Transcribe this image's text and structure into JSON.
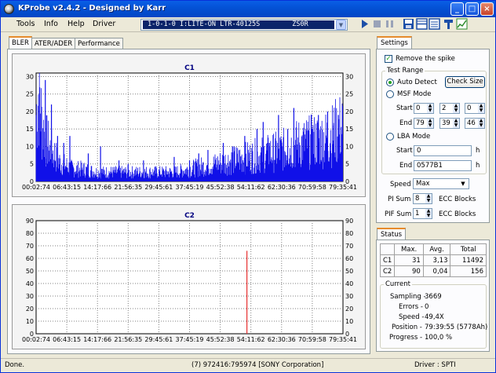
{
  "window": {
    "title": "KProbe v2.4.2 - Designed by Karr"
  },
  "menu": [
    "Tools",
    "Info",
    "Help",
    "Driver"
  ],
  "drive": {
    "selected": "1-0-1-0 I:LITE-ON LTR-40125S        ZS0R"
  },
  "toolbar_icons": [
    "play-icon",
    "stop-icon",
    "pause-icon",
    "save-icon",
    "layout-icon",
    "list-icon",
    "tools-icon",
    "graph-icon"
  ],
  "tabs": [
    "BLER",
    "ATER/ADER",
    "Performance"
  ],
  "chart_data": [
    {
      "type": "bar",
      "title": "C1",
      "xticks": [
        "00:02:74",
        "06:43:15",
        "14:17:66",
        "21:56:35",
        "29:45:61",
        "37:45:19",
        "45:52:38",
        "54:11:62",
        "62:30:36",
        "70:59:58",
        "79:35:41"
      ],
      "yticks": [
        0,
        5,
        10,
        15,
        20,
        25,
        30
      ],
      "ylim": [
        0,
        31
      ],
      "grid": true,
      "profile": [
        [
          0.0,
          22
        ],
        [
          0.01,
          30
        ],
        [
          0.02,
          18
        ],
        [
          0.03,
          14
        ],
        [
          0.04,
          12
        ],
        [
          0.05,
          10
        ],
        [
          0.06,
          9
        ],
        [
          0.07,
          7
        ],
        [
          0.08,
          6
        ],
        [
          0.1,
          5
        ],
        [
          0.12,
          4
        ],
        [
          0.15,
          4
        ],
        [
          0.2,
          3
        ],
        [
          0.25,
          3
        ],
        [
          0.3,
          3
        ],
        [
          0.35,
          3
        ],
        [
          0.4,
          3
        ],
        [
          0.45,
          3
        ],
        [
          0.5,
          4
        ],
        [
          0.55,
          5
        ],
        [
          0.6,
          6
        ],
        [
          0.65,
          7
        ],
        [
          0.7,
          8
        ],
        [
          0.75,
          9
        ],
        [
          0.8,
          10
        ],
        [
          0.85,
          12
        ],
        [
          0.9,
          13
        ],
        [
          0.95,
          14
        ],
        [
          1.0,
          18
        ]
      ],
      "spikes": [
        [
          0.03,
          29
        ],
        [
          0.05,
          22
        ],
        [
          0.07,
          13
        ],
        [
          0.09,
          11
        ],
        [
          0.11,
          13
        ],
        [
          0.17,
          8
        ],
        [
          0.21,
          10
        ],
        [
          0.27,
          6
        ],
        [
          0.3,
          5
        ],
        [
          0.35,
          6
        ],
        [
          0.45,
          7
        ],
        [
          0.5,
          6
        ],
        [
          0.53,
          8
        ],
        [
          0.56,
          9
        ],
        [
          0.61,
          11
        ],
        [
          0.64,
          10
        ],
        [
          0.68,
          13
        ],
        [
          0.72,
          15
        ],
        [
          0.74,
          17
        ],
        [
          0.76,
          11
        ],
        [
          0.79,
          19
        ],
        [
          0.82,
          15
        ],
        [
          0.84,
          21
        ],
        [
          0.88,
          12
        ],
        [
          0.9,
          15
        ],
        [
          0.92,
          19
        ],
        [
          0.95,
          20
        ],
        [
          0.97,
          16
        ],
        [
          0.985,
          19
        ]
      ]
    },
    {
      "type": "bar",
      "title": "C2",
      "xticks": [
        "00:02:74",
        "06:43:15",
        "14:17:66",
        "21:56:35",
        "29:45:61",
        "37:45:19",
        "45:52:38",
        "54:11:62",
        "62:30:36",
        "70:59:58",
        "79:35:41"
      ],
      "yticks": [
        0,
        10,
        20,
        30,
        40,
        50,
        60,
        70,
        80,
        90
      ],
      "ylim": [
        0,
        90
      ],
      "grid": true,
      "spikes": [
        [
          0.687,
          66
        ]
      ]
    }
  ],
  "settings": {
    "tab": "Settings",
    "remove_spike": "Remove the spike",
    "test_range": "Test Range",
    "auto_detect": "Auto Detect",
    "check_size": "Check Size",
    "msf_mode": "MSF Mode",
    "start": "Start",
    "end": "End",
    "msf_start": [
      "0",
      "2",
      "0"
    ],
    "msf_end": [
      "79",
      "39",
      "46"
    ],
    "lba_mode": "LBA Mode",
    "lba_start": "0",
    "lba_end": "0577B1",
    "h": "h",
    "speed_label": "Speed",
    "speed_value": "Max",
    "pi_sum": "PI Sum",
    "pi_sum_value": "8",
    "pif_sum": "PIF Sum",
    "pif_sum_value": "1",
    "ecc_blocks": "ECC Blocks"
  },
  "status": {
    "tab": "Status",
    "headers": [
      "",
      "Max.",
      "Avg.",
      "Total"
    ],
    "rows": [
      [
        "C1",
        "31",
        "3,13",
        "11492"
      ],
      [
        "C2",
        "90",
        "0,04",
        "156"
      ]
    ],
    "current_title": "Current",
    "sampling_label": "Sampling -",
    "sampling_value": "3669",
    "errors_label": "Errors -",
    "errors_value": "0",
    "speed_label": "Speed -",
    "speed_value": "49,4X",
    "position_label": "Position -",
    "position_value": "79:39:55 (5778Ah)",
    "progress_label": "Progress -",
    "progress_value": "100,0 %"
  },
  "statusbar": {
    "left": "Done.",
    "center": "(7) 972416:795974 [SONY Corporation]",
    "right": "Driver : SPTI"
  }
}
